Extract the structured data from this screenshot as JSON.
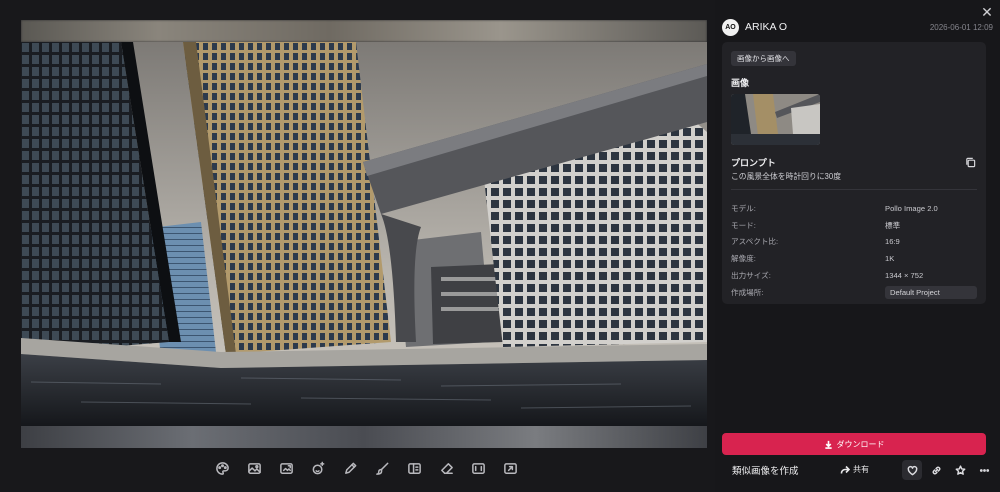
{
  "user": {
    "name": "ARIKA O",
    "avatar_text": "AO",
    "timestamp": "2026-06-01 12:09"
  },
  "actions": {
    "image_to_image": "画像から画像へ",
    "download": "ダウンロード",
    "create_similar": "類似画像を作成",
    "share": "共有"
  },
  "sections": {
    "image": "画像",
    "prompt": "プロンプト"
  },
  "prompt_text": "この風景全体を時計回りに30度",
  "meta": [
    {
      "label": "モデル:",
      "value": "Pollo Image 2.0"
    },
    {
      "label": "モード:",
      "value": "標準"
    },
    {
      "label": "アスペクト比:",
      "value": "16:9"
    },
    {
      "label": "解像度:",
      "value": "1K"
    },
    {
      "label": "出力サイズ:",
      "value": "1344 × 752"
    },
    {
      "label": "作成場所:",
      "value": "Default Project"
    }
  ],
  "toolbar_icons": [
    "palette-icon",
    "image-edit-icon",
    "image-expand-icon",
    "sparkle-face-icon",
    "pen-icon",
    "brush-icon",
    "layers-icon",
    "eraser-icon",
    "crop-icon",
    "upscale-icon"
  ],
  "colors": {
    "accent": "#d8234f",
    "panel_bg": "#17171a",
    "card_bg": "#222226"
  }
}
